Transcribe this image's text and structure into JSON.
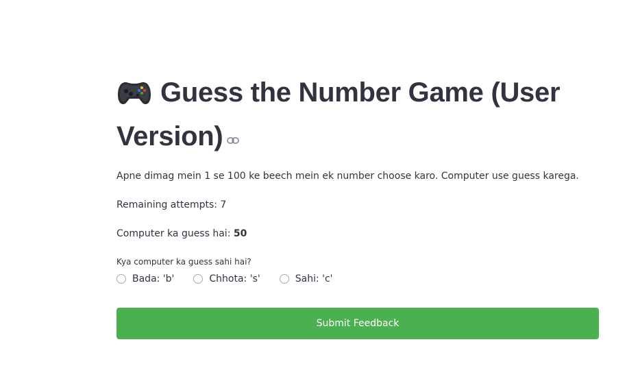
{
  "header": {
    "title": "Guess the Number Game (User Version)",
    "title_icon": "game-controller-icon",
    "anchor_icon": "link-icon"
  },
  "content": {
    "instructions": "Apne dimag mein 1 se 100 ke beech mein ek number choose karo. Computer use guess karega.",
    "remaining_attempts": "Remaining attempts: 7",
    "guess_prefix": "Computer ka guess hai: ",
    "guess_value": "50"
  },
  "feedback": {
    "question": "Kya computer ka guess sahi hai?",
    "options": [
      "Bada: 'b'",
      "Chhota: 's'",
      "Sahi: 'c'"
    ],
    "selected": null
  },
  "actions": {
    "submit_label": "Submit Feedback",
    "submit_color": "#4caf50"
  }
}
